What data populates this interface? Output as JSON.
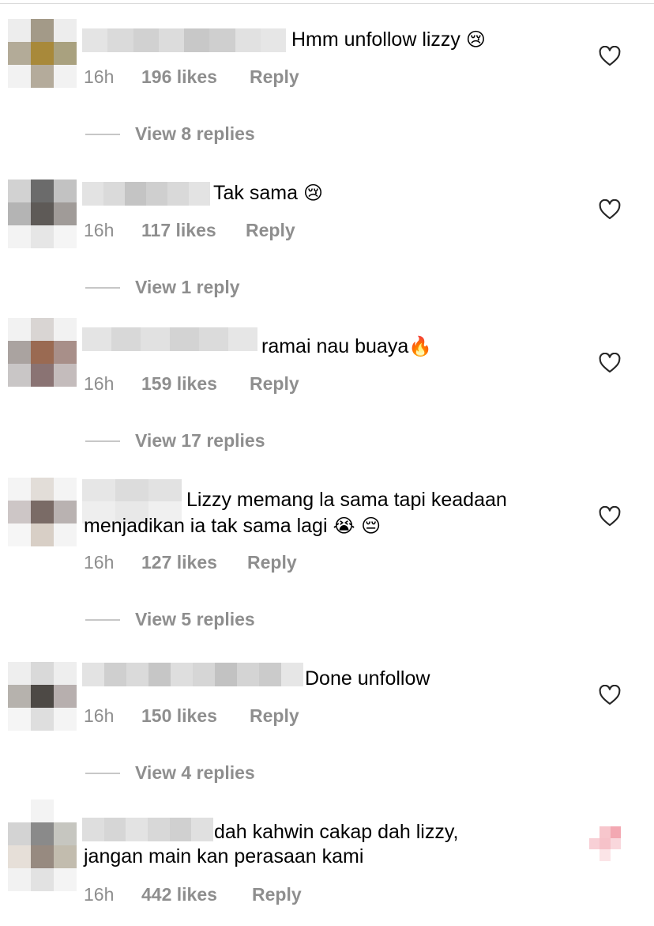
{
  "colors": {
    "muted": "#8e8e8e",
    "divider": "#dbdbdb",
    "text": "#000000"
  },
  "comments": [
    {
      "text": "Hmm unfollow lizzy",
      "emoji": "😢",
      "time": "16h",
      "likes": "196 likes",
      "reply": "Reply",
      "view_replies": "View 8 replies"
    },
    {
      "text": "Tak sama",
      "emoji": "😢",
      "time": "16h",
      "likes": "117 likes",
      "reply": "Reply",
      "view_replies": "View 1 reply"
    },
    {
      "text": "ramai nau buaya",
      "emoji": "🔥",
      "time": "16h",
      "likes": "159 likes",
      "reply": "Reply",
      "view_replies": "View 17 replies"
    },
    {
      "text_line1": "Lizzy memang la sama tapi keadaan",
      "text_line2": "menjadikan ia tak sama lagi",
      "emoji": "😭 😔",
      "time": "16h",
      "likes": "127 likes",
      "reply": "Reply",
      "view_replies": "View 5 replies"
    },
    {
      "text": "Done unfollow",
      "time": "16h",
      "likes": "150 likes",
      "reply": "Reply",
      "view_replies": "View 4 replies"
    },
    {
      "text_line1": "dah kahwin cakap dah lizzy,",
      "text_line2": "jangan main kan perasaan kami",
      "time": "16h",
      "likes": "442 likes",
      "reply": "Reply"
    }
  ]
}
